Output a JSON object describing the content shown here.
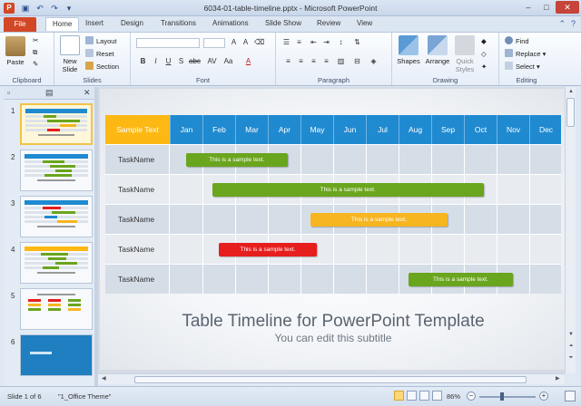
{
  "window": {
    "title": "6034-01-table-timeline.pptx - Microsoft PowerPoint",
    "app_icon": "P"
  },
  "tabs": [
    "File",
    "Home",
    "Insert",
    "Design",
    "Transitions",
    "Animations",
    "Slide Show",
    "Review",
    "View"
  ],
  "ribbon": {
    "clipboard": {
      "paste": "Paste",
      "label": "Clipboard"
    },
    "slides": {
      "new_slide": "New Slide",
      "layout": "Layout",
      "reset": "Reset",
      "section": "Section",
      "label": "Slides"
    },
    "font": {
      "label": "Font"
    },
    "paragraph": {
      "label": "Paragraph"
    },
    "drawing": {
      "shapes": "Shapes",
      "arrange": "Arrange",
      "quick_styles": "Quick Styles",
      "label": "Drawing"
    },
    "editing": {
      "find": "Find",
      "replace": "Replace",
      "select": "Select",
      "label": "Editing"
    }
  },
  "thumbnails": [
    "1",
    "2",
    "3",
    "4",
    "5",
    "6"
  ],
  "slide": {
    "header_label": "Sample Text",
    "months": [
      "Jan",
      "Feb",
      "Mar",
      "Apr",
      "May",
      "Jun",
      "Jul",
      "Aug",
      "Sep",
      "Oct",
      "Nov",
      "Dec"
    ],
    "tasks": [
      {
        "name": "TaskName",
        "bar_text": "This is a sample text.",
        "color": "#6aa51e",
        "start": 0.5,
        "end": 3.6
      },
      {
        "name": "TaskName",
        "bar_text": "This is a sample text.",
        "color": "#6aa51e",
        "start": 1.3,
        "end": 9.6
      },
      {
        "name": "TaskName",
        "bar_text": "This is a sample text.",
        "color": "#f7b520",
        "start": 4.3,
        "end": 8.5
      },
      {
        "name": "TaskName",
        "bar_text": "This is a sample text.",
        "color": "#e61e1e",
        "start": 1.5,
        "end": 4.5
      },
      {
        "name": "TaskName",
        "bar_text": "This is a sample text.",
        "color": "#6aa51e",
        "start": 7.3,
        "end": 10.5
      }
    ],
    "title": "Table Timeline for PowerPoint Template",
    "subtitle": "You can edit this subtitle"
  },
  "status": {
    "slide_info": "Slide 1 of 6",
    "theme": "\"1_Office Theme\"",
    "zoom": "86%"
  },
  "colors": {
    "header_blue": "#1f8ad0",
    "corner_orange": "#fdb813",
    "file_tab": "#d24726"
  }
}
